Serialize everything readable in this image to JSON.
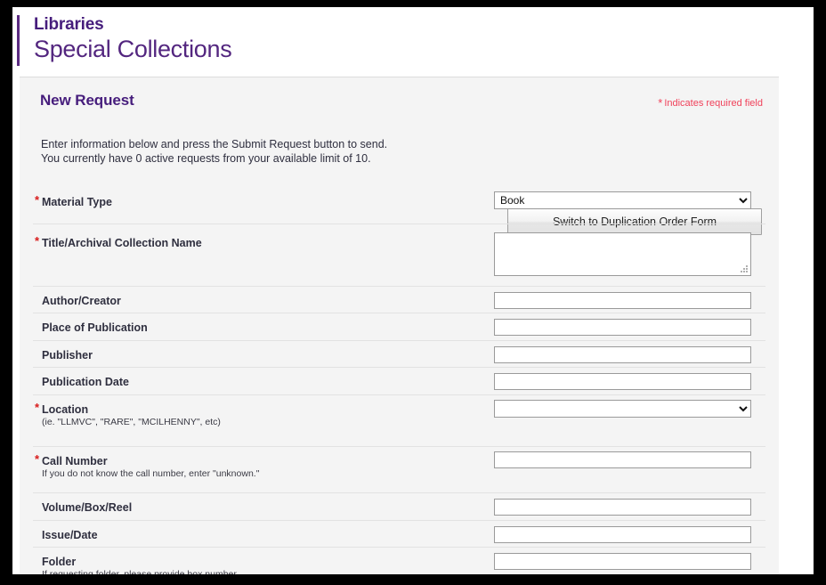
{
  "brand": {
    "line1": "Libraries",
    "line2": "Special Collections",
    "purple": "#461D7C"
  },
  "panel": {
    "title": "New Request",
    "required_note": "Indicates required field",
    "required_star": "*",
    "intro_line1": "Enter information below and press the Submit Request button to send.",
    "intro_line2": "You currently have 0 active requests from your available limit of 10.",
    "switch_button": "Switch to Duplication Order Form"
  },
  "form": {
    "rows": [
      {
        "label": "Material Type",
        "required": true,
        "type": "select",
        "value": "Book",
        "hint": ""
      },
      {
        "label": "Title/Archival Collection Name",
        "required": true,
        "type": "textarea",
        "value": "",
        "hint": ""
      },
      {
        "label": "Author/Creator",
        "required": false,
        "type": "text",
        "value": "",
        "hint": ""
      },
      {
        "label": "Place of Publication",
        "required": false,
        "type": "text",
        "value": "",
        "hint": ""
      },
      {
        "label": "Publisher",
        "required": false,
        "type": "text",
        "value": "",
        "hint": ""
      },
      {
        "label": "Publication Date",
        "required": false,
        "type": "text",
        "value": "",
        "hint": ""
      },
      {
        "label": "Location",
        "required": true,
        "type": "select",
        "value": "",
        "hint": "(ie. \"LLMVC\", \"RARE\", \"MCILHENNY\", etc)"
      },
      {
        "label": "Call Number",
        "required": true,
        "type": "text",
        "value": "",
        "hint": "If you do not know the call number, enter \"unknown.\""
      },
      {
        "label": "Volume/Box/Reel",
        "required": false,
        "type": "text",
        "value": "",
        "hint": ""
      },
      {
        "label": "Issue/Date",
        "required": false,
        "type": "text",
        "value": "",
        "hint": ""
      },
      {
        "label": "Folder",
        "required": false,
        "type": "text",
        "value": "",
        "hint": "If requesting folder, please provide box number."
      }
    ],
    "material_type_options": [
      "Book"
    ],
    "location_options": [
      ""
    ]
  }
}
